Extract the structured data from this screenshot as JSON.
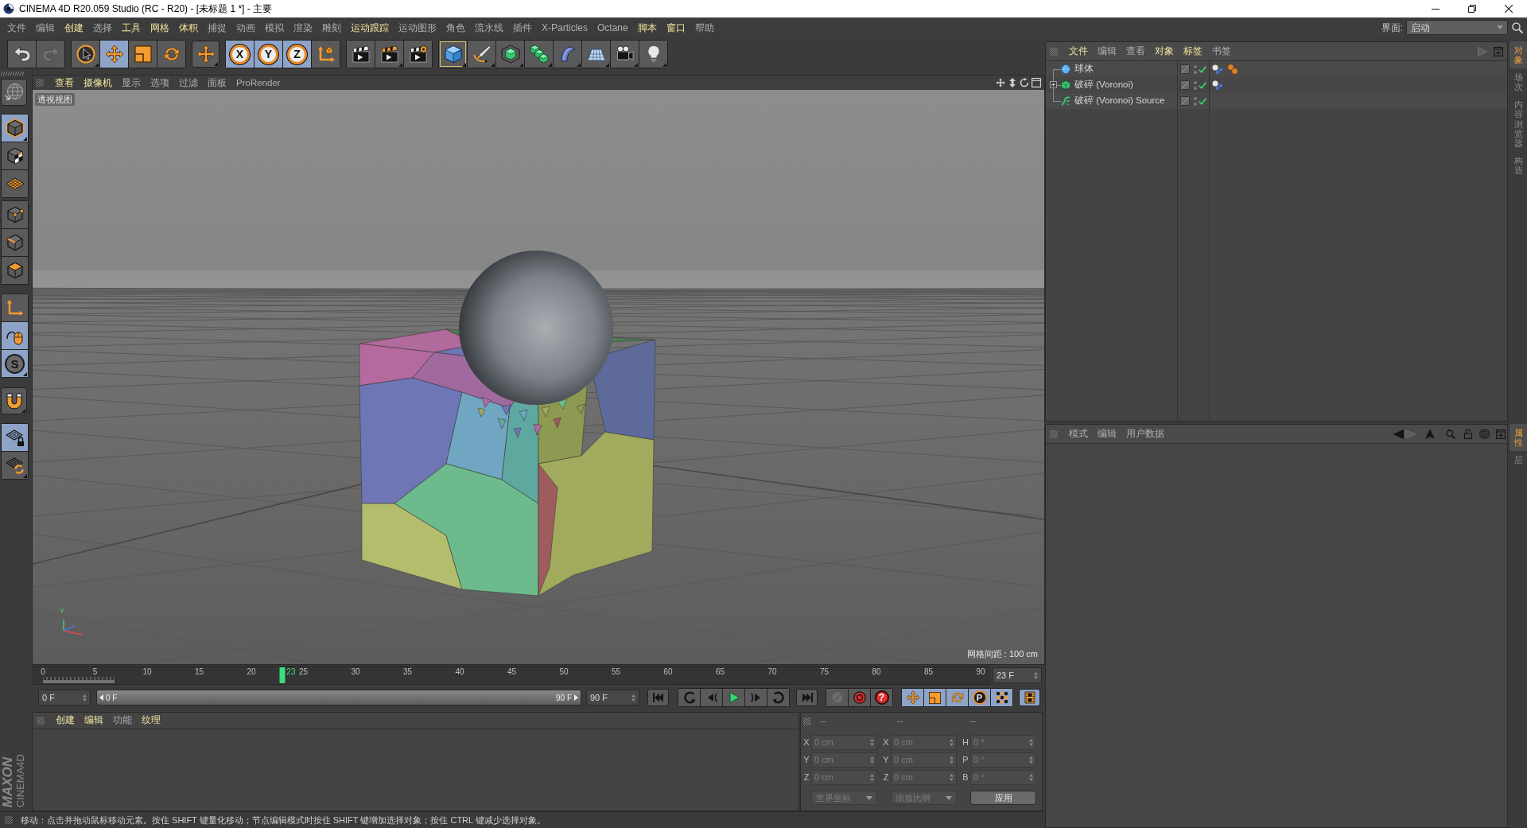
{
  "window": {
    "title": "CINEMA 4D R20.059 Studio (RC - R20) - [未标题 1 *] - 主要"
  },
  "menu_bar": {
    "items": [
      {
        "label": "文件",
        "highlighted": false
      },
      {
        "label": "编辑",
        "highlighted": false
      },
      {
        "label": "创建",
        "highlighted": true
      },
      {
        "label": "选择",
        "highlighted": false
      },
      {
        "label": "工具",
        "highlighted": true
      },
      {
        "label": "网格",
        "highlighted": true
      },
      {
        "label": "体积",
        "highlighted": true
      },
      {
        "label": "捕捉",
        "highlighted": false
      },
      {
        "label": "动画",
        "highlighted": false
      },
      {
        "label": "模拟",
        "highlighted": false
      },
      {
        "label": "渲染",
        "highlighted": false
      },
      {
        "label": "雕刻",
        "highlighted": false
      },
      {
        "label": "运动跟踪",
        "highlighted": true
      },
      {
        "label": "运动图形",
        "highlighted": false
      },
      {
        "label": "角色",
        "highlighted": false
      },
      {
        "label": "流水线",
        "highlighted": false
      },
      {
        "label": "插件",
        "highlighted": false
      },
      {
        "label": "X-Particles",
        "highlighted": false
      },
      {
        "label": "Octane",
        "highlighted": false
      },
      {
        "label": "脚本",
        "highlighted": true
      },
      {
        "label": "窗口",
        "highlighted": true
      },
      {
        "label": "帮助",
        "highlighted": false
      }
    ],
    "layout_label": "界面:",
    "layout_value": "启动"
  },
  "main_toolbar": {
    "groups": [
      {
        "buttons": [
          {
            "selected": false,
            "disabled": false,
            "hovered": false
          },
          {
            "selected": false,
            "disabled": true,
            "hovered": false
          }
        ]
      },
      {
        "buttons": [
          {
            "selected": false,
            "disabled": false,
            "hovered": false
          },
          {
            "selected": true,
            "disabled": false,
            "hovered": false
          },
          {
            "selected": false,
            "disabled": false,
            "hovered": false
          },
          {
            "selected": false,
            "disabled": false,
            "hovered": false
          }
        ]
      },
      {
        "buttons": [
          {
            "selected": false,
            "disabled": false,
            "hovered": false
          }
        ]
      },
      {
        "buttons": [
          {
            "label": "X",
            "selected": true,
            "disabled": false,
            "hovered": false
          },
          {
            "label": "Y",
            "selected": true,
            "disabled": false,
            "hovered": false
          },
          {
            "label": "Z",
            "selected": true,
            "disabled": false,
            "hovered": false
          },
          {
            "selected": false,
            "disabled": false,
            "hovered": false
          }
        ]
      },
      {
        "buttons": [
          {
            "selected": false,
            "disabled": false,
            "hovered": false
          },
          {
            "selected": false,
            "disabled": false,
            "hovered": false
          },
          {
            "selected": false,
            "disabled": false,
            "hovered": false
          }
        ]
      },
      {
        "buttons": [
          {
            "selected": false,
            "disabled": false,
            "hovered": true
          },
          {
            "selected": false,
            "disabled": false,
            "hovered": false
          },
          {
            "selected": false,
            "disabled": false,
            "hovered": false
          },
          {
            "selected": false,
            "disabled": false,
            "hovered": false
          },
          {
            "selected": false,
            "disabled": false,
            "hovered": false
          },
          {
            "selected": false,
            "disabled": false,
            "hovered": false
          },
          {
            "selected": false,
            "disabled": false,
            "hovered": false
          },
          {
            "selected": false,
            "disabled": false,
            "hovered": false
          }
        ]
      }
    ]
  },
  "left_toolbar": {
    "groups": [
      {
        "buttons": [
          {
            "selected": false
          }
        ]
      },
      {
        "buttons": [
          {
            "selected": true
          },
          {
            "selected": false
          },
          {
            "selected": false
          }
        ]
      },
      {
        "buttons": [
          {
            "selected": false
          },
          {
            "selected": false
          },
          {
            "selected": false
          }
        ]
      },
      {
        "buttons": [
          {
            "selected": false
          },
          {
            "selected": true
          },
          {
            "label": "S",
            "selected": true
          }
        ]
      },
      {
        "buttons": [
          {
            "selected": false
          }
        ]
      },
      {
        "buttons": [
          {
            "selected": true
          },
          {
            "selected": false
          }
        ]
      }
    ]
  },
  "viewport": {
    "menu": [
      {
        "label": "查看",
        "highlighted": true
      },
      {
        "label": "摄像机",
        "highlighted": true
      },
      {
        "label": "显示",
        "highlighted": false
      },
      {
        "label": "选项",
        "highlighted": false
      },
      {
        "label": "过滤",
        "highlighted": false
      },
      {
        "label": "面板",
        "highlighted": false
      },
      {
        "label": "ProRender",
        "highlighted": false
      }
    ],
    "view_name": "透视视图",
    "grid_spacing": "网格间距 : 100 cm",
    "axis_label": "Y"
  },
  "timeline": {
    "ticks": [
      "0",
      "5",
      "10",
      "15",
      "20",
      "25",
      "30",
      "35",
      "40",
      "45",
      "50",
      "55",
      "60",
      "65",
      "70",
      "75",
      "80",
      "85",
      "90"
    ],
    "playhead": {
      "label": "23",
      "level": 0.2556
    },
    "current_frame": "23 F"
  },
  "transport": {
    "start_field": "0 F",
    "range": {
      "start": "0 F",
      "end": "90 F",
      "level": 1
    },
    "end_field": "90 F",
    "groups": [
      {
        "buttons": [
          {
            "selected": false,
            "disabled": false
          }
        ]
      },
      {
        "buttons": [
          {
            "selected": false,
            "disabled": false
          },
          {
            "selected": false,
            "disabled": false
          },
          {
            "selected": false,
            "disabled": false
          },
          {
            "selected": false,
            "disabled": false
          },
          {
            "selected": false,
            "disabled": false
          }
        ]
      },
      {
        "buttons": [
          {
            "selected": false,
            "disabled": false
          }
        ]
      },
      {
        "buttons": [
          {
            "selected": false,
            "disabled": true
          },
          {
            "selected": false,
            "disabled": false
          },
          {
            "label": "?",
            "selected": false,
            "disabled": false
          }
        ]
      },
      {
        "buttons": [
          {
            "selected": true,
            "disabled": false
          },
          {
            "selected": true,
            "disabled": false
          },
          {
            "selected": true,
            "disabled": false
          },
          {
            "label": "P",
            "selected": true,
            "disabled": false
          },
          {
            "selected": true,
            "disabled": false
          }
        ]
      },
      {
        "buttons": [
          {
            "selected": true,
            "disabled": false
          }
        ]
      }
    ]
  },
  "material_manager": {
    "menu": [
      {
        "label": "创建",
        "highlighted": true
      },
      {
        "label": "编辑",
        "highlighted": true
      },
      {
        "label": "功能",
        "highlighted": false
      },
      {
        "label": "纹理",
        "highlighted": true
      }
    ]
  },
  "branding": {
    "line_1": "MAXON",
    "line_2": "CINEMA4D"
  },
  "coordinates": {
    "disabled": true,
    "headers": [
      "--",
      "--",
      "--"
    ],
    "rows": [
      {
        "cells": [
          {
            "label": "X",
            "value": "0 cm"
          },
          {
            "label": "X",
            "value": "0 cm"
          },
          {
            "label": "H",
            "value": "0 °"
          }
        ]
      },
      {
        "cells": [
          {
            "label": "Y",
            "value": "0 cm"
          },
          {
            "label": "Y",
            "value": "0 cm"
          },
          {
            "label": "P",
            "value": "0 °"
          }
        ]
      },
      {
        "cells": [
          {
            "label": "Z",
            "value": "0 cm"
          },
          {
            "label": "Z",
            "value": "0 cm"
          },
          {
            "label": "B",
            "value": "0 °"
          }
        ]
      }
    ],
    "system_dropdown": "世界坐标",
    "mode_dropdown": "缩放比例",
    "apply_button": "应用"
  },
  "status_bar": {
    "text": "移动：点击并拖动鼠标移动元素。按住 SHIFT 键量化移动；节点编辑模式时按住 SHIFT 键增加选择对象；按住 CTRL 键减少选择对象。"
  },
  "object_manager": {
    "menu": [
      {
        "label": "文件",
        "highlighted": true
      },
      {
        "label": "编辑",
        "highlighted": false
      },
      {
        "label": "查看",
        "highlighted": false
      },
      {
        "label": "对象",
        "highlighted": true
      },
      {
        "label": "标签",
        "highlighted": true
      },
      {
        "label": "书签",
        "highlighted": false
      }
    ],
    "objects": [
      {
        "name": "球体",
        "collapsed": false,
        "enabled": true,
        "tags": [
          {
            "kind": "cluster"
          },
          {
            "kind": "pair"
          }
        ]
      },
      {
        "name": "破碎 (Voronoi)",
        "collapsed": true,
        "enabled": true,
        "tags": [
          {
            "kind": "cluster"
          }
        ]
      },
      {
        "name": "破碎 (Voronoi) Source",
        "collapsed": false,
        "enabled": true
      }
    ]
  },
  "attribute_manager": {
    "menu": [
      {
        "label": "模式",
        "highlighted": false
      },
      {
        "label": "编辑",
        "highlighted": false
      },
      {
        "label": "用户数据",
        "highlighted": false
      }
    ]
  },
  "side_tabs": {
    "top": [
      {
        "label": "对象",
        "selected": true
      },
      {
        "label": "场次",
        "selected": false
      },
      {
        "label": "内容浏览器",
        "selected": false
      },
      {
        "label": "构造",
        "selected": false
      }
    ],
    "bottom": [
      {
        "label": "属性",
        "selected": true
      },
      {
        "label": "层",
        "selected": false
      }
    ]
  }
}
